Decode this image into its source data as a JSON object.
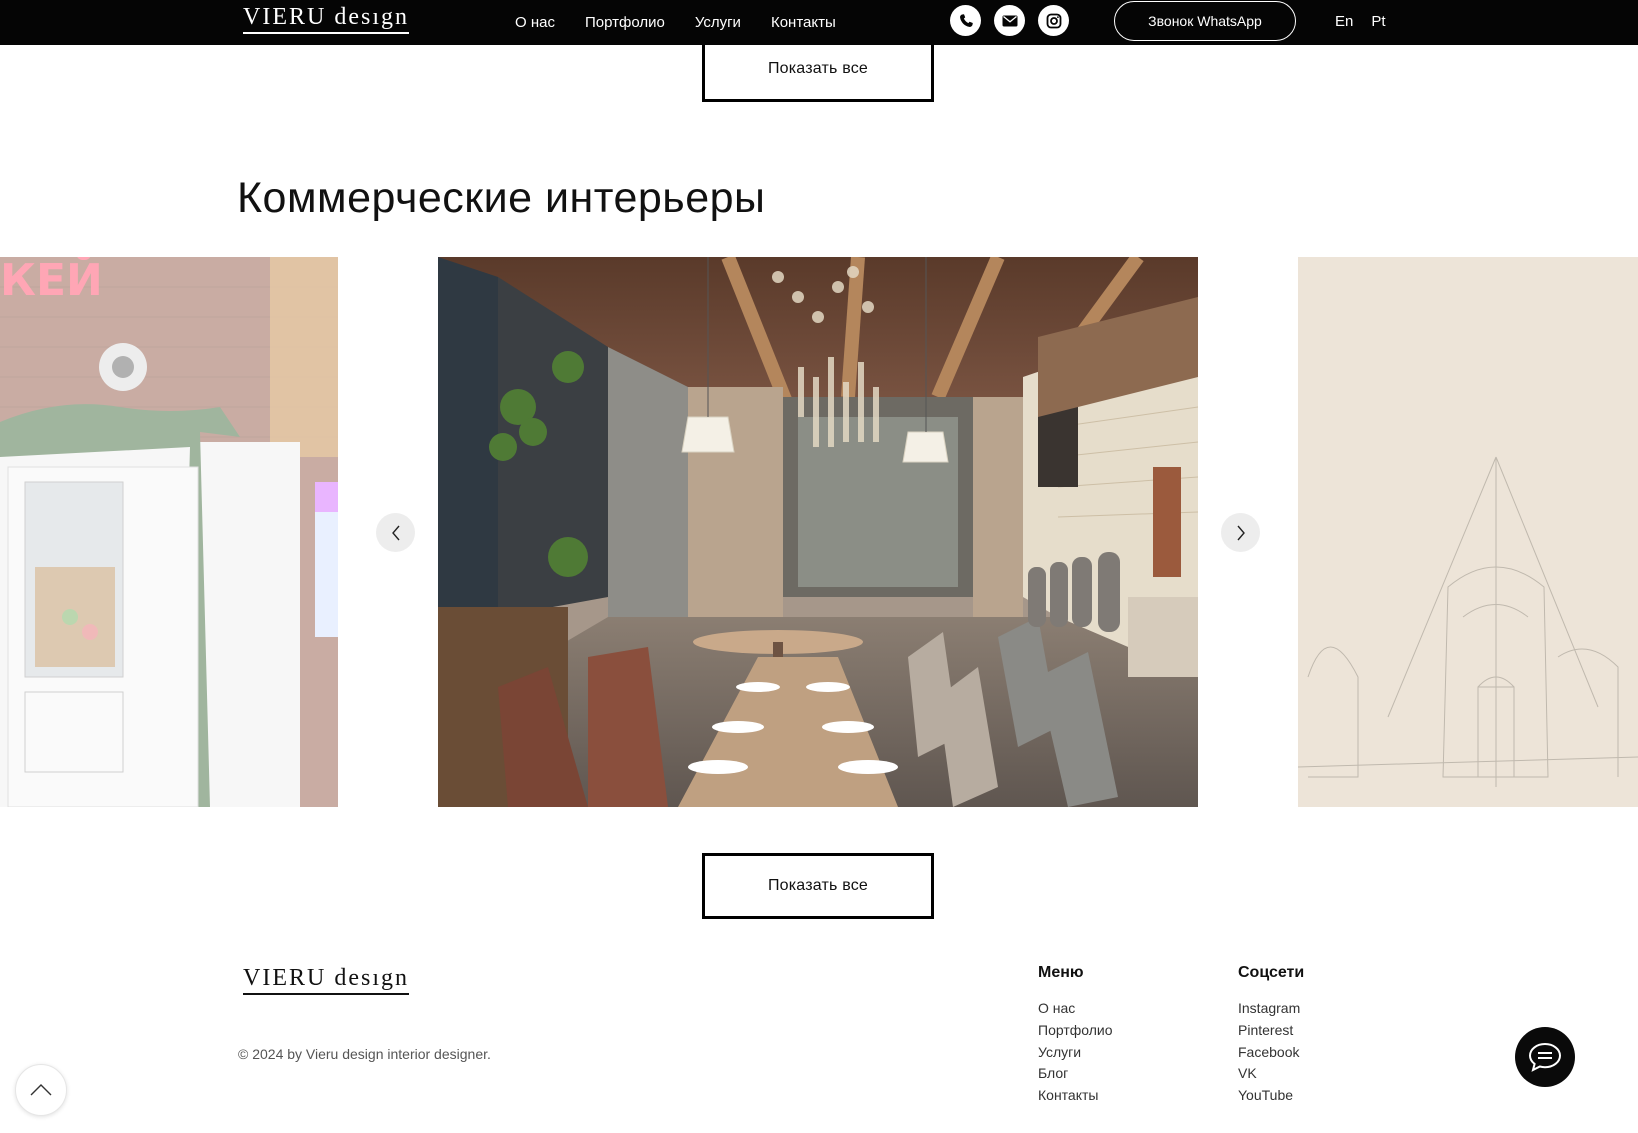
{
  "header": {
    "logo_main": "VIERU",
    "logo_sub": "desıgn",
    "nav": [
      {
        "label": "О нас"
      },
      {
        "label": "Портфолио"
      },
      {
        "label": "Услуги"
      },
      {
        "label": "Контакты"
      }
    ],
    "social_icons": [
      "phone-icon",
      "mail-icon",
      "instagram-icon"
    ],
    "whatsapp_button": "Звонок WhatsApp",
    "languages": [
      "En",
      "Pt"
    ]
  },
  "section": {
    "show_all_label": "Показать все",
    "title": "Коммерческие интерьеры",
    "carousel": {
      "slides": [
        "shop-entrance-photo",
        "restaurant-interior-render",
        "pencil-sketch-drawing"
      ],
      "prev_icon": "chevron-left-icon",
      "next_icon": "chevron-right-icon"
    },
    "show_all_bottom_label": "Показать все"
  },
  "footer": {
    "logo_main": "VIERU",
    "logo_sub": "desıgn",
    "copyright": "© 2024 by Vieru design interior designer.",
    "menu": {
      "title": "Меню",
      "items": [
        "О нас",
        "Портфолио",
        "Услуги",
        "Блог",
        "Контакты"
      ]
    },
    "social": {
      "title": "Соцсети",
      "items": [
        "Instagram",
        "Pinterest",
        "Facebook",
        "VK",
        "YouTube"
      ]
    }
  },
  "floating": {
    "chat_icon": "chat-bubble-icon",
    "scroll_top_icon": "chevron-up-icon"
  },
  "colors": {
    "header_bg": "#050505",
    "page_bg": "#ffffff",
    "text": "#111111"
  }
}
